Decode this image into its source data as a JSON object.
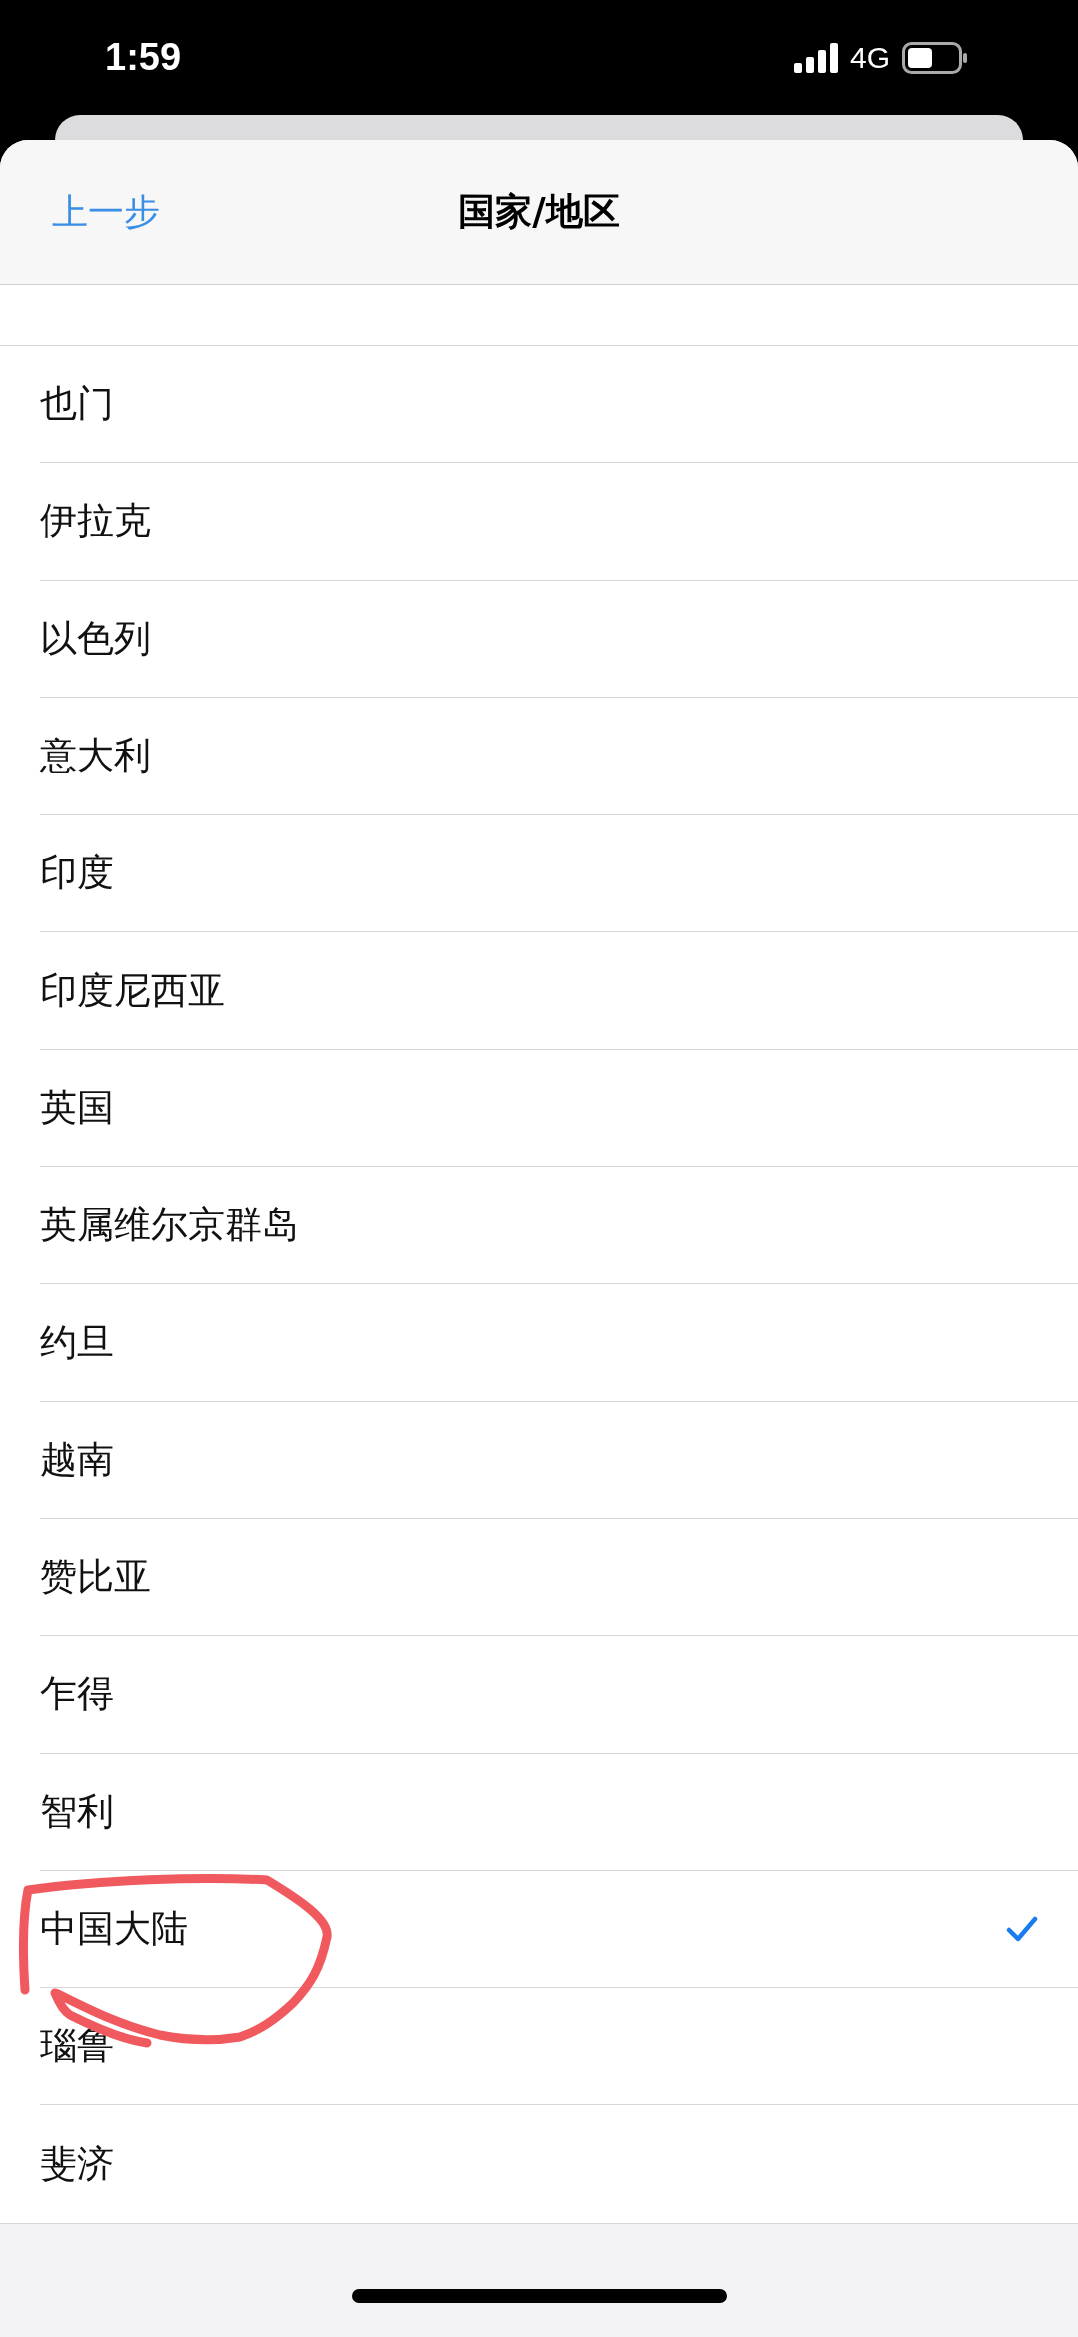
{
  "status_bar": {
    "time": "1:59",
    "network": "4G"
  },
  "nav": {
    "back": "上一步",
    "title": "国家/地区"
  },
  "rows": [
    {
      "label": "也门",
      "selected": false
    },
    {
      "label": "伊拉克",
      "selected": false
    },
    {
      "label": "以色列",
      "selected": false
    },
    {
      "label": "意大利",
      "selected": false
    },
    {
      "label": "印度",
      "selected": false
    },
    {
      "label": "印度尼西亚",
      "selected": false
    },
    {
      "label": "英国",
      "selected": false
    },
    {
      "label": "英属维尔京群岛",
      "selected": false
    },
    {
      "label": "约旦",
      "selected": false
    },
    {
      "label": "越南",
      "selected": false
    },
    {
      "label": "赞比亚",
      "selected": false
    },
    {
      "label": "乍得",
      "selected": false
    },
    {
      "label": "智利",
      "selected": false
    },
    {
      "label": "中国大陆",
      "selected": true,
      "annotated": true
    },
    {
      "label": "瑙鲁",
      "selected": false
    },
    {
      "label": "斐济",
      "selected": false
    }
  ]
}
